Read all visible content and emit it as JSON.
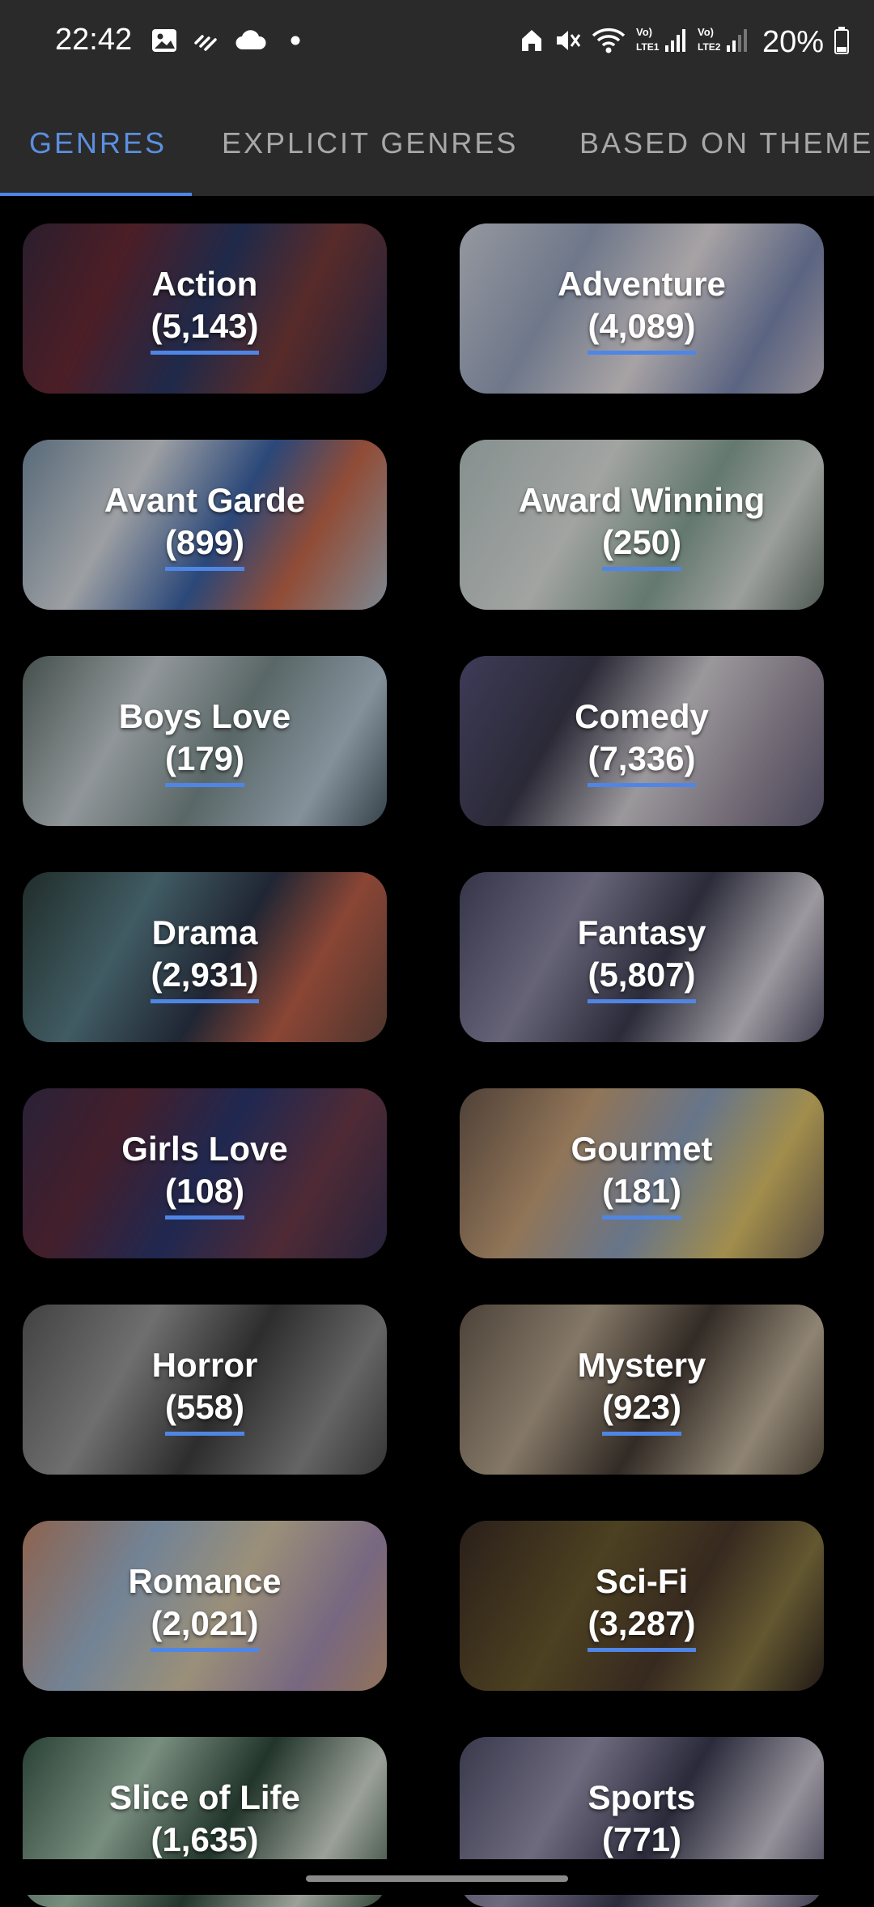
{
  "status_bar": {
    "time": "22:42",
    "battery": "20%",
    "left_icons": [
      "image-icon",
      "wifi-calling-icon",
      "cloud-icon",
      "dot-icon"
    ],
    "right_icons": [
      "home-icon",
      "mute-icon",
      "wifi-icon",
      "signal-lte1-icon",
      "signal-lte2-icon",
      "battery-icon"
    ]
  },
  "tabs": [
    {
      "label": "GENRES",
      "active": true
    },
    {
      "label": "EXPLICIT GENRES",
      "active": false
    },
    {
      "label": "BASED ON THEME",
      "active": false
    }
  ],
  "genres": [
    {
      "name": "Action",
      "count": "(5,143)"
    },
    {
      "name": "Adventure",
      "count": "(4,089)"
    },
    {
      "name": "Avant Garde",
      "count": "(899)"
    },
    {
      "name": "Award Winning",
      "count": "(250)"
    },
    {
      "name": "Boys Love",
      "count": "(179)"
    },
    {
      "name": "Comedy",
      "count": "(7,336)"
    },
    {
      "name": "Drama",
      "count": "(2,931)"
    },
    {
      "name": "Fantasy",
      "count": "(5,807)"
    },
    {
      "name": "Girls Love",
      "count": "(108)"
    },
    {
      "name": "Gourmet",
      "count": "(181)"
    },
    {
      "name": "Horror",
      "count": "(558)"
    },
    {
      "name": "Mystery",
      "count": "(923)"
    },
    {
      "name": "Romance",
      "count": "(2,021)"
    },
    {
      "name": "Sci-Fi",
      "count": "(3,287)"
    },
    {
      "name": "Slice of Life",
      "count": "(1,635)"
    },
    {
      "name": "Sports",
      "count": "(771)"
    }
  ],
  "colors": {
    "accent": "#4f86e6",
    "active_tab": "#5b8fe0",
    "inactive_tab": "#a8a8a8",
    "bar_background": "#2a2a2a",
    "page_background": "#000000"
  }
}
